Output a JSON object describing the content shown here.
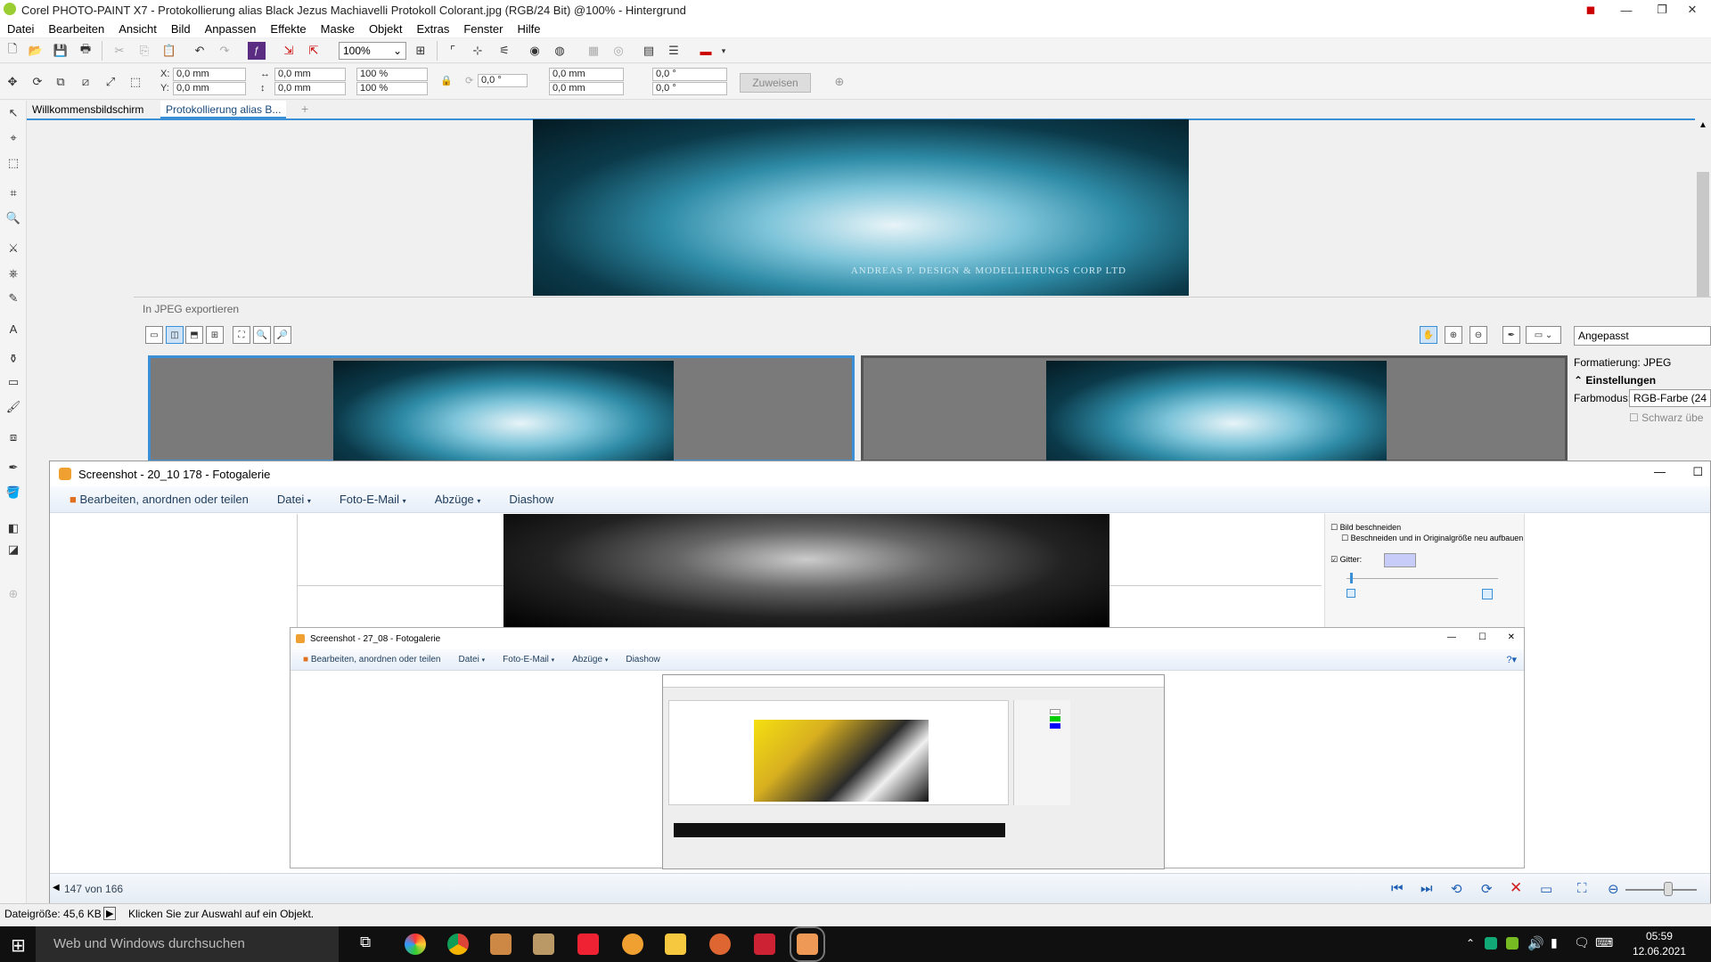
{
  "corel": {
    "title": "Corel PHOTO-PAINT X7 - Protokollierung alias Black Jezus Machiavelli Protokoll Colorant.jpg (RGB/24 Bit) @100% - Hintergrund",
    "menu": [
      "Datei",
      "Bearbeiten",
      "Ansicht",
      "Bild",
      "Anpassen",
      "Effekte",
      "Maske",
      "Objekt",
      "Extras",
      "Fenster",
      "Hilfe"
    ],
    "zoom": "100%",
    "props": {
      "x": "0,0 mm",
      "y": "0,0 mm",
      "w": "0,0 mm",
      "h": "0,0 mm",
      "sx": "100 %",
      "sy": "100 %",
      "rot": "0,0 °",
      "cx": "0,0 mm",
      "cy": "0,0 mm",
      "skx": "0,0 °",
      "sky": "0,0 °",
      "assign": "Zuweisen"
    },
    "tabs": [
      "Willkommensbildschirm",
      "Protokollierung alias B..."
    ],
    "watermark": "ANDREAS P. DESIGN & MODELLIERUNGS CORP LTD",
    "status": {
      "size": "Dateigröße: 45,6 KB",
      "hint": "Klicken Sie zur Auswahl auf ein Objekt."
    }
  },
  "jpeg_dialog": {
    "title": "In JPEG exportieren",
    "preset": "Angepasst",
    "format_label": "Formatierung:",
    "format_value": "JPEG",
    "settings": "Einstellungen",
    "color_mode_label": "Farbmodus:",
    "color_mode_value": "RGB-Farbe (24",
    "black_label": "Schwarz übe"
  },
  "gallery": {
    "title": "Screenshot - 20_10 178 - Fotogalerie",
    "menu": [
      "Bearbeiten, anordnen oder teilen",
      "Datei",
      "Foto-E-Mail",
      "Abzüge",
      "Diashow"
    ],
    "side": {
      "crop": "Bild beschneiden",
      "crop_orig": "Beschneiden und in Originalgröße neu aufbauen",
      "grid": "Gitter:"
    },
    "counter": "147 von 166"
  },
  "inner_gallery": {
    "title": "Screenshot - 27_08 - Fotogalerie",
    "menu": [
      "Bearbeiten, anordnen oder teilen",
      "Datei",
      "Foto-E-Mail",
      "Abzüge",
      "Diashow"
    ]
  },
  "taskbar": {
    "search": "Web und Windows durchsuchen",
    "time": "05:59",
    "date": "12.06.2021"
  }
}
